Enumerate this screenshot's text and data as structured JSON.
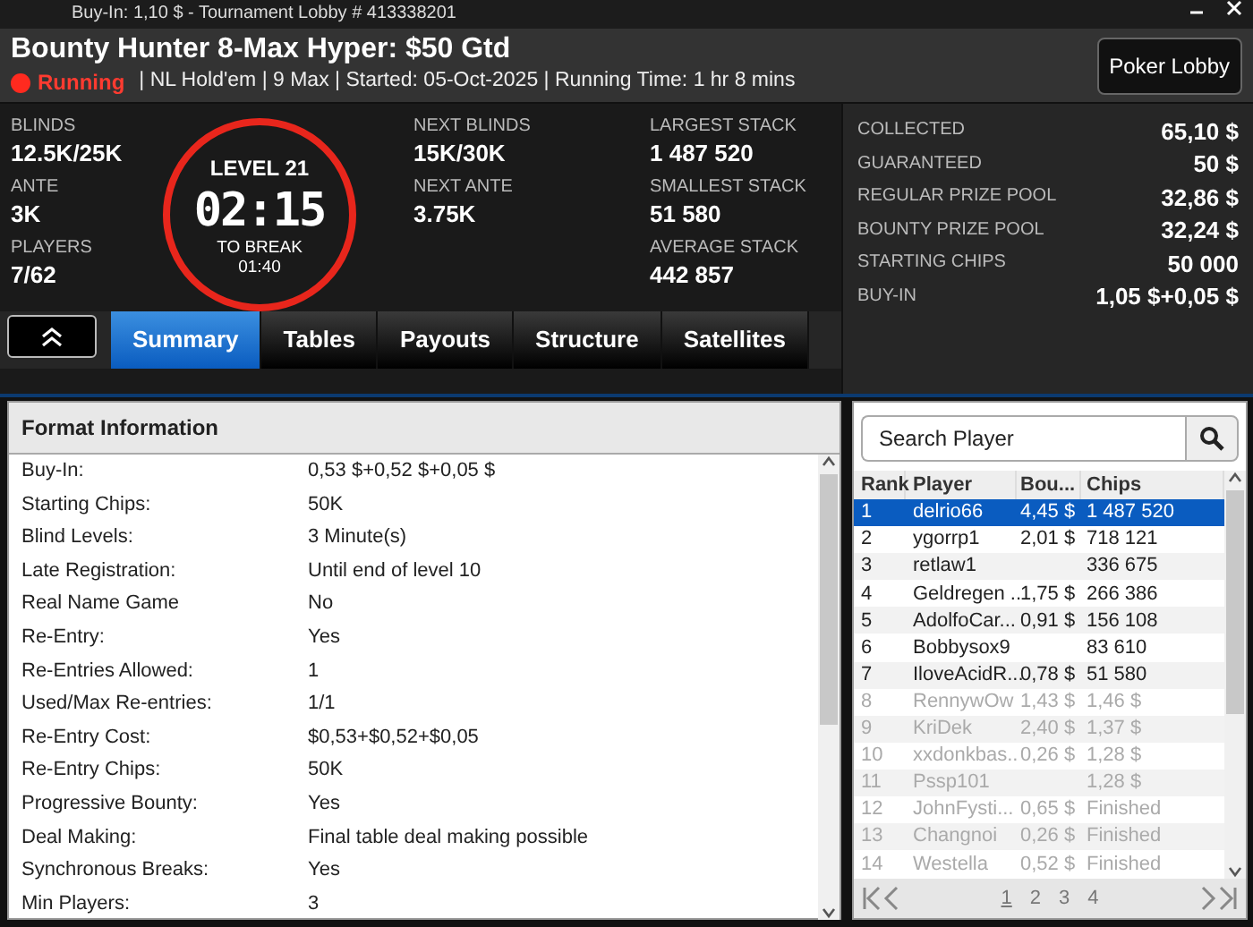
{
  "window": {
    "title": "Buy-In: 1,10 $ - Tournament Lobby # 413338201"
  },
  "header": {
    "title": "Bounty Hunter 8-Max Hyper: $50 Gtd",
    "status": "Running",
    "running": true,
    "details": "| NL Hold'em | 9 Max | Started: 05-Oct-2025  | Running Time: 1 hr  8 mins",
    "lobby_button": "Poker Lobby"
  },
  "stats_left": [
    {
      "label": "BLINDS",
      "value": "12.5K/25K"
    },
    {
      "label": "ANTE",
      "value": "3K"
    },
    {
      "label": "PLAYERS",
      "value": "7/62"
    }
  ],
  "clock": {
    "level": "LEVEL 21",
    "time": "02:15",
    "break_label": "TO BREAK",
    "break_time": "01:40"
  },
  "stats_mid": [
    {
      "label": "NEXT BLINDS",
      "value": "15K/30K"
    },
    {
      "label": "NEXT ANTE",
      "value": "3.75K"
    }
  ],
  "stats_stack": [
    {
      "label": "LARGEST STACK",
      "value": "1 487 520"
    },
    {
      "label": "SMALLEST STACK",
      "value": "51 580"
    },
    {
      "label": "AVERAGE STACK",
      "value": "442 857"
    }
  ],
  "prize_info": [
    {
      "label": "COLLECTED",
      "value": "65,10 $"
    },
    {
      "label": "GUARANTEED",
      "value": "50 $"
    },
    {
      "label": "REGULAR PRIZE POOL",
      "value": "32,86 $"
    },
    {
      "label": "BOUNTY PRIZE POOL",
      "value": "32,24 $"
    },
    {
      "label": "STARTING CHIPS",
      "value": "50 000"
    },
    {
      "label": "BUY-IN",
      "value": "1,05 $+0,05 $"
    }
  ],
  "tabs": [
    {
      "label": "Summary",
      "selected": true
    },
    {
      "label": "Tables",
      "selected": false
    },
    {
      "label": "Payouts",
      "selected": false
    },
    {
      "label": "Structure",
      "selected": false
    },
    {
      "label": "Satellites",
      "selected": false
    }
  ],
  "format_info": {
    "title": "Format Information",
    "rows": [
      {
        "label": "Buy-In:",
        "value": "0,53 $+0,52 $+0,05 $"
      },
      {
        "label": "Starting Chips:",
        "value": "50K"
      },
      {
        "label": "Blind Levels:",
        "value": "3 Minute(s)"
      },
      {
        "label": "Late Registration:",
        "value": "Until end of level 10"
      },
      {
        "label": "Real Name Game",
        "value": "No"
      },
      {
        "label": "Re-Entry:",
        "value": "Yes"
      },
      {
        "label": "Re-Entries Allowed:",
        "value": "1"
      },
      {
        "label": "Used/Max Re-entries:",
        "value": "1/1"
      },
      {
        "label": "Re-Entry Cost:",
        "value": "$0,53+$0,52+$0,05"
      },
      {
        "label": "Re-Entry Chips:",
        "value": "50K"
      },
      {
        "label": "Progressive Bounty:",
        "value": "Yes"
      },
      {
        "label": "Deal Making:",
        "value": "Final table deal making possible"
      },
      {
        "label": "Synchronous Breaks:",
        "value": "Yes"
      },
      {
        "label": "Min Players:",
        "value": "3"
      }
    ]
  },
  "players": {
    "search": {
      "placeholder": "Search Player"
    },
    "columns": [
      "Rank",
      "Player",
      "Bou...",
      "Chips"
    ],
    "rows": [
      {
        "rank": "1",
        "player": "delrio66",
        "bounty": "4,45 $",
        "chips": "1 487 520",
        "selected": true,
        "finished": false
      },
      {
        "rank": "2",
        "player": "ygorrp1",
        "bounty": "2,01 $",
        "chips": "718 121",
        "selected": false,
        "finished": false
      },
      {
        "rank": "3",
        "player": "retlaw1",
        "bounty": "",
        "chips": "336 675",
        "selected": false,
        "finished": false
      },
      {
        "rank": "4",
        "player": "Geldregen ..",
        "bounty": "1,75 $",
        "chips": "266 386",
        "selected": false,
        "finished": false
      },
      {
        "rank": "5",
        "player": "AdolfoCar...",
        "bounty": "0,91 $",
        "chips": "156 108",
        "selected": false,
        "finished": false
      },
      {
        "rank": "6",
        "player": "Bobbysox9",
        "bounty": "",
        "chips": "83 610",
        "selected": false,
        "finished": false
      },
      {
        "rank": "7",
        "player": "IloveAcidR...",
        "bounty": "0,78 $",
        "chips": "51 580",
        "selected": false,
        "finished": false
      },
      {
        "rank": "8",
        "player": "RennywOw",
        "bounty": "1,43 $",
        "chips": "1,46 $",
        "selected": false,
        "finished": true
      },
      {
        "rank": "9",
        "player": "KriDek",
        "bounty": "2,40 $",
        "chips": "1,37 $",
        "selected": false,
        "finished": true
      },
      {
        "rank": "10",
        "player": "xxdonkbas..",
        "bounty": "0,26 $",
        "chips": "1,28 $",
        "selected": false,
        "finished": true
      },
      {
        "rank": "11",
        "player": "Pssp101",
        "bounty": "",
        "chips": "1,28 $",
        "selected": false,
        "finished": true
      },
      {
        "rank": "12",
        "player": "JohnFysti...",
        "bounty": "0,65 $",
        "chips": "Finished",
        "selected": false,
        "finished": true
      },
      {
        "rank": "13",
        "player": "Changnoi",
        "bounty": "0,26 $",
        "chips": "Finished",
        "selected": false,
        "finished": true
      },
      {
        "rank": "14",
        "player": "Westella",
        "bounty": "0,52 $",
        "chips": "Finished",
        "selected": false,
        "finished": true
      }
    ],
    "pages": [
      {
        "label": "1",
        "selected": true
      },
      {
        "label": "2",
        "selected": false
      },
      {
        "label": "3",
        "selected": false
      },
      {
        "label": "4",
        "selected": false
      }
    ]
  }
}
